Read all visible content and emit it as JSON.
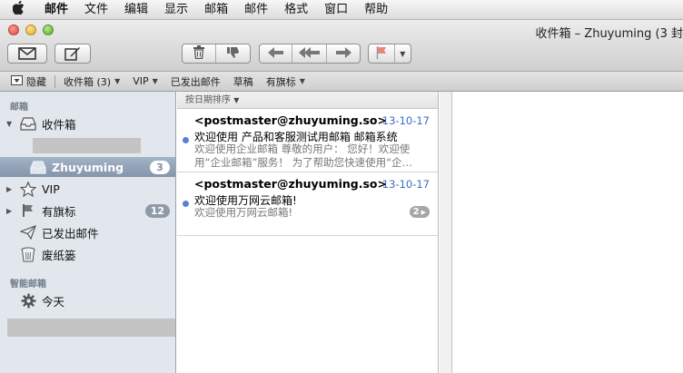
{
  "menubar": {
    "items": [
      "邮件",
      "文件",
      "编辑",
      "显示",
      "邮箱",
      "邮件",
      "格式",
      "窗口",
      "帮助"
    ]
  },
  "window": {
    "title": "收件箱 – Zhuyuming (3 封"
  },
  "toolbar": {
    "icons": [
      "envelope-icon",
      "compose-icon",
      "trash-icon",
      "junk-icon",
      "reply-icon",
      "reply-all-icon",
      "forward-icon",
      "flag-icon"
    ]
  },
  "favorites": {
    "hide": "隐藏",
    "inbox": "收件箱 (3)",
    "vip": "VIP",
    "sent": "已发出邮件",
    "drafts": "草稿",
    "flagged": "有旗标"
  },
  "sidebar": {
    "section_mailbox": "邮箱",
    "inbox": "收件箱",
    "account": "Zhuyuming",
    "account_count": "3",
    "vip": "VIP",
    "flagged": "有旗标",
    "flagged_count": "12",
    "sent": "已发出邮件",
    "trash": "废纸篓",
    "section_smart": "智能邮箱",
    "today": "今天"
  },
  "list": {
    "sort_label": "按日期排序",
    "messages": [
      {
        "from": "<postmaster@zhuyuming.so>",
        "date": "13-10-17",
        "subject": "欢迎使用 产品和客服测试用邮箱 邮箱系统",
        "preview": "欢迎使用企业邮箱 尊敬的用户： 您好！欢迎使用“企业邮箱”服务！ 为了帮助您快速使用“企…"
      },
      {
        "from": "<postmaster@zhuyuming.so>",
        "date": "13-10-17",
        "subject": "欢迎使用万网云邮箱!",
        "preview": "欢迎使用万网云邮箱!",
        "thread_count": "2"
      }
    ]
  },
  "colors": {
    "accent_blue": "#3b6ec7",
    "selection": "#8496ab",
    "unread_dot": "#5b7fd2"
  }
}
